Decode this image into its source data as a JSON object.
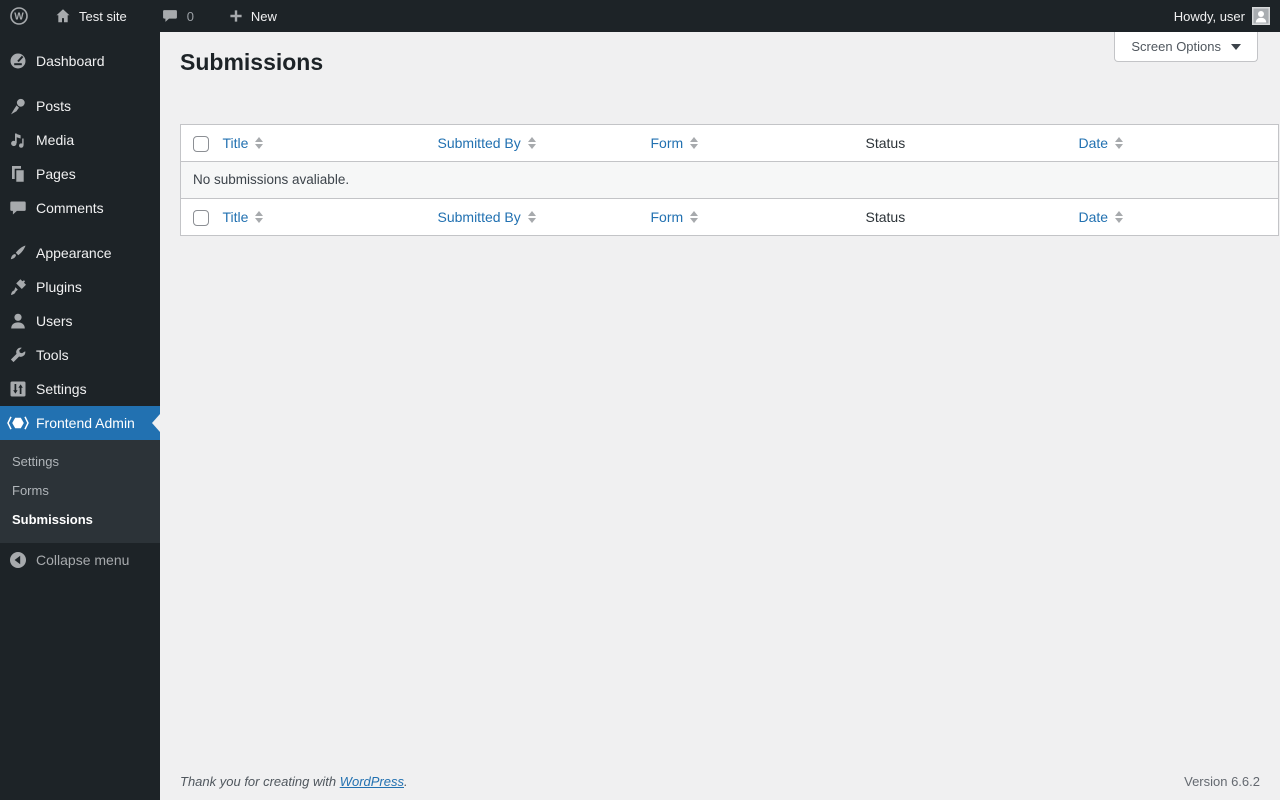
{
  "admin_bar": {
    "site_name": "Test site",
    "comment_count": "0",
    "new_label": "New",
    "howdy": "Howdy, user"
  },
  "sidebar": {
    "items": [
      {
        "label": "Dashboard",
        "icon": "dashboard-icon"
      },
      {
        "label": "Posts",
        "icon": "pin-icon"
      },
      {
        "label": "Media",
        "icon": "media-notes-icon"
      },
      {
        "label": "Pages",
        "icon": "pages-icon"
      },
      {
        "label": "Comments",
        "icon": "comment-bubble-icon"
      },
      {
        "label": "Appearance",
        "icon": "paintbrush-icon"
      },
      {
        "label": "Plugins",
        "icon": "plugin-icon"
      },
      {
        "label": "Users",
        "icon": "user-icon"
      },
      {
        "label": "Tools",
        "icon": "wrench-icon"
      },
      {
        "label": "Settings",
        "icon": "sliders-icon"
      },
      {
        "label": "Frontend Admin",
        "icon": "hexagon-brackets-icon",
        "active": true
      }
    ],
    "submenu": {
      "items": [
        {
          "label": "Settings"
        },
        {
          "label": "Forms"
        },
        {
          "label": "Submissions",
          "current": true
        }
      ]
    },
    "collapse_label": "Collapse menu"
  },
  "main": {
    "page_title": "Submissions",
    "screen_options_label": "Screen Options",
    "table": {
      "columns": [
        {
          "label": "Title",
          "sortable": true
        },
        {
          "label": "Submitted By",
          "sortable": true
        },
        {
          "label": "Form",
          "sortable": true
        },
        {
          "label": "Status",
          "sortable": false
        },
        {
          "label": "Date",
          "sortable": true
        }
      ],
      "empty_message": "No submissions avaliable."
    }
  },
  "footer": {
    "thanks_prefix": "Thank you for creating with ",
    "wordpress_link": "WordPress",
    "thanks_suffix": ".",
    "version": "Version 6.6.2"
  },
  "icons": {
    "wordpress-logo-icon": "W in circle",
    "home-icon": "house glyph",
    "comment-bubble-icon": "speech bubble",
    "plus-icon": "plus sign",
    "avatar": "person silhouette square",
    "dropdown-arrow-icon": "down triangle",
    "sort-arrows-icon": "up+down triangles",
    "collapse-arrow-icon": "left arrow in circle"
  },
  "colors": {
    "admin_bar_bg": "#1d2327",
    "sidebar_bg": "#1d2327",
    "submenu_bg": "#2c3338",
    "active_accent": "#2271b1",
    "content_bg": "#f0f0f1",
    "link_blue": "#2271b1",
    "table_border": "#c3c4c7",
    "empty_row_bg": "#f6f7f7"
  }
}
